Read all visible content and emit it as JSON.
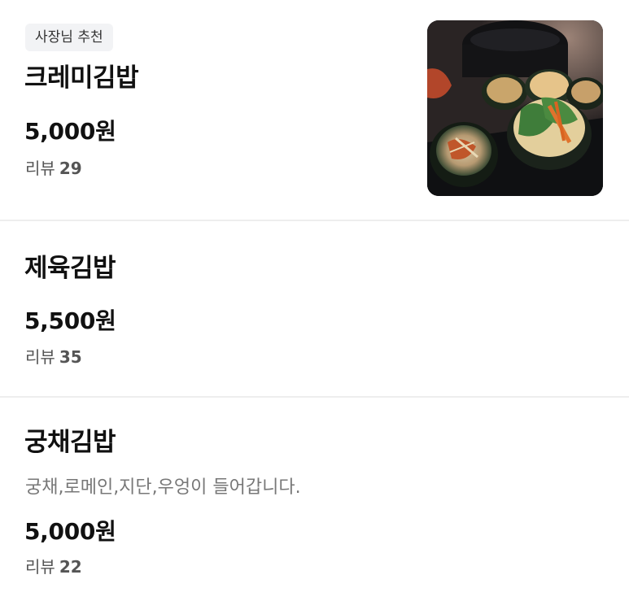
{
  "menu_items": [
    {
      "badge": "사장님 추천",
      "name": "크레미김밥",
      "price": "5,000원",
      "review_label": "리뷰",
      "review_count": "29",
      "image_icon": "gimbap-photo"
    },
    {
      "name": "제육김밥",
      "price": "5,500원",
      "review_label": "리뷰",
      "review_count": "35"
    },
    {
      "name": "궁채김밥",
      "description": "궁채,로메인,지단,우엉이 들어갑니다.",
      "price": "5,000원",
      "review_label": "리뷰",
      "review_count": "22"
    }
  ],
  "colors": {
    "text_primary": "#111111",
    "text_secondary": "#555555",
    "text_description": "#777777",
    "badge_bg": "#f2f3f5",
    "divider": "#eeeeee"
  }
}
